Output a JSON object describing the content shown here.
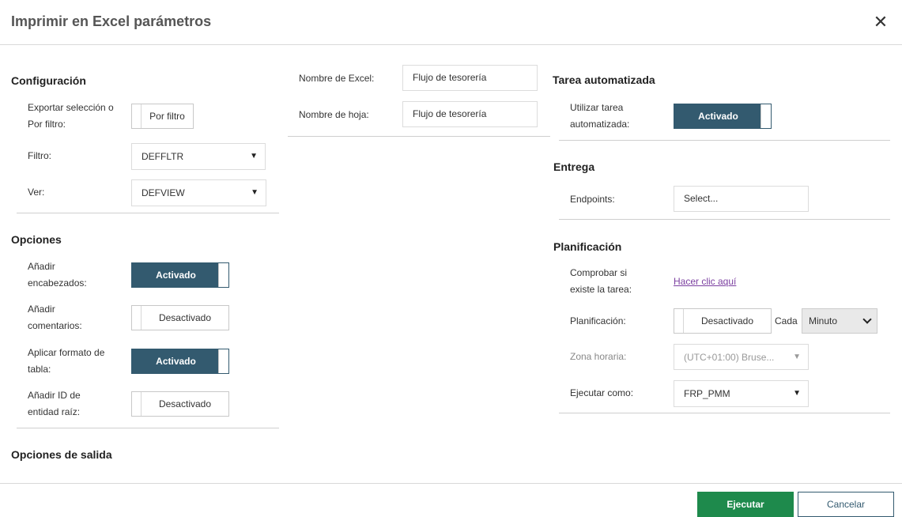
{
  "dialog": {
    "title": "Imprimir en Excel parámetros",
    "close_symbol": "✕"
  },
  "config": {
    "title": "Configuración",
    "export_label": "Exportar selección o Por filtro:",
    "export_toggle": "Por filtro",
    "filter_label": "Filtro:",
    "filter_value": "DEFFLTR",
    "view_label": "Ver:",
    "view_value": "DEFVIEW"
  },
  "names": {
    "excel_label": "Nombre de Excel:",
    "excel_value": "Flujo de tesorería",
    "sheet_label": "Nombre de hoja:",
    "sheet_value": "Flujo de tesorería"
  },
  "options": {
    "title": "Opciones",
    "headers_label": "Añadir encabezados:",
    "headers_value": "Activado",
    "comments_label": "Añadir comentarios:",
    "comments_value": "Desactivado",
    "table_label": "Aplicar formato de tabla:",
    "table_value": "Activado",
    "rootid_label": "Añadir ID de entidad raíz:",
    "rootid_value": "Desactivado"
  },
  "output": {
    "title": "Opciones de salida"
  },
  "automation": {
    "title": "Tarea automatizada",
    "use_label": "Utilizar tarea automatizada:",
    "use_value": "Activado"
  },
  "delivery": {
    "title": "Entrega",
    "endpoints_label": "Endpoints:",
    "endpoints_value": "Select..."
  },
  "schedule": {
    "title": "Planificación",
    "check_label": "Comprobar si existe la tarea:",
    "check_link": "Hacer clic aquí",
    "plan_label": "Planificación:",
    "plan_value": "Desactivado",
    "every_label": "Cada",
    "every_value": "Minuto",
    "tz_label": "Zona horaria:",
    "tz_value": "(UTC+01:00) Bruse...",
    "runas_label": "Ejecutar como:",
    "runas_value": "FRP_PMM"
  },
  "footer": {
    "run": "Ejecutar",
    "cancel": "Cancelar"
  },
  "colors": {
    "toggle_on": "#335a6f",
    "primary": "#1e8a4c",
    "link": "#7b3fa0"
  }
}
